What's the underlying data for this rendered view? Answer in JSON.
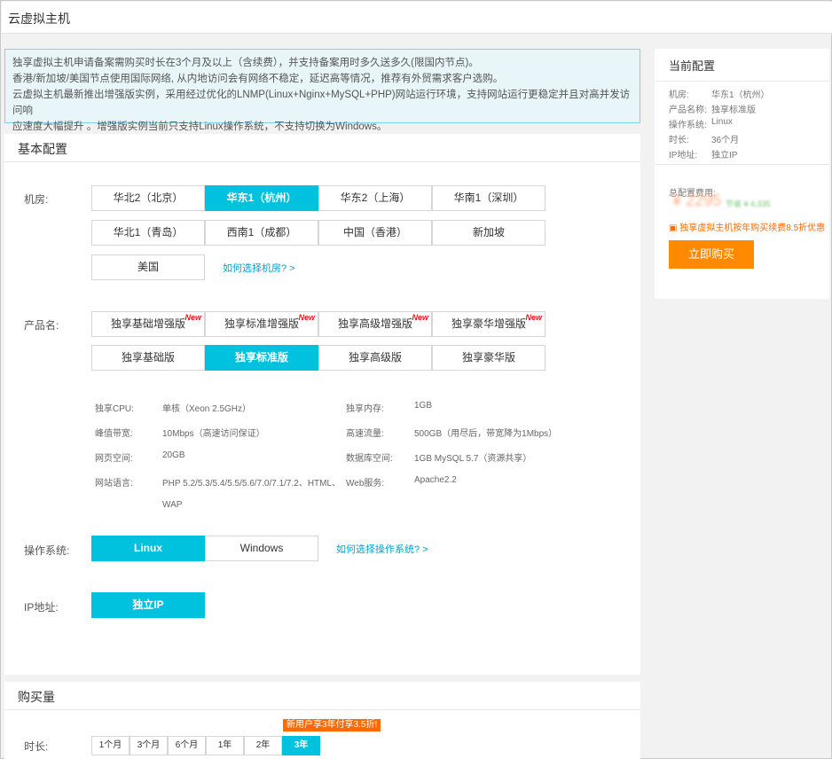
{
  "page_title": "云虚拟主机",
  "notice_lines": [
    "独享虚拟主机申请备案需购买时长在3个月及以上（含续费），并支持备案用时多久送多久(限国内节点)。",
    "香港/新加坡/美国节点使用国际网络, 从内地访问会有网络不稳定，延迟高等情况，推荐有外贸需求客户选购。",
    "云虚拟主机最新推出增强版实例，采用经过优化的LNMP(Linux+Nginx+MySQL+PHP)网站运行环境，支持网站运行更稳定并且对高并发访问响",
    "应速度大幅提升 。增强版实例当前只支持Linux操作系统，不支持切换为Windows。"
  ],
  "basic": {
    "title": "基本配置",
    "room_label": "机房:",
    "rooms": [
      "华北2（北京）",
      "华东1（杭州）",
      "华东2（上海）",
      "华南1（深圳）",
      "华北1（青岛）",
      "西南1（成都）",
      "中国（香港）",
      "新加坡",
      "美国"
    ],
    "room_selected": 1,
    "room_help": "如何选择机房? >",
    "product_label": "产品名:",
    "products_enhanced": [
      "独享基础增强版",
      "独享标准增强版",
      "独享高级增强版",
      "独享豪华增强版"
    ],
    "new_badge": "New",
    "products_normal": [
      "独享基础版",
      "独享标准版",
      "独享高级版",
      "独享豪华版"
    ],
    "product_selected": "独享标准版",
    "specs": {
      "cpu_k": "独享CPU:",
      "cpu_v": "单核（Xeon 2.5GHz）",
      "mem_k": "独享内存:",
      "mem_v": "1GB",
      "bw_k": "峰值带宽:",
      "bw_v": "10Mbps（高速访问保证）",
      "traffic_k": "高速流量:",
      "traffic_v": "500GB（用尽后，带宽降为1Mbps）",
      "space_k": "网页空间:",
      "space_v": "20GB",
      "db_k": "数据库空间:",
      "db_v": "1GB MySQL 5.7（资源共享）",
      "lang_k": "网站语言:",
      "lang_v": "PHP 5.2/5.3/5.4/5.5/5.6/7.0/7.1/7.2、HTML、",
      "lang_v2": "WAP",
      "web_k": "Web服务:",
      "web_v": "Apache2.2"
    },
    "os_label": "操作系统:",
    "os_options": [
      "Linux",
      "Windows"
    ],
    "os_selected": "Linux",
    "os_help": "如何选择操作系统? >",
    "ip_label": "IP地址:",
    "ip_option": "独立IP"
  },
  "purchase": {
    "title": "购买量",
    "duration_label": "时长:",
    "durations": [
      "1个月",
      "3个月",
      "6个月",
      "1年",
      "2年",
      "3年"
    ],
    "duration_selected": "3年",
    "promo_tag": "新用户享3年付享3.5折!"
  },
  "side": {
    "title": "当前配置",
    "rows": [
      {
        "k": "机房:",
        "v": "华东1（杭州）"
      },
      {
        "k": "产品名称:",
        "v": "独享标准版"
      },
      {
        "k": "操作系统:",
        "v": "Linux"
      },
      {
        "k": "时长:",
        "v": "36个月"
      },
      {
        "k": "IP地址:",
        "v": "独立IP"
      }
    ],
    "total_label": "总配置费用:",
    "price": "¥ 2295",
    "price_note": "节省 ¥ 4,335",
    "promo": "独享虚拟主机按年购买续费8.5折优惠",
    "buy_label": "立即购买"
  },
  "colors": {
    "accent": "#00c1de",
    "orange": "#ff8a00",
    "promo": "#ff6a00",
    "new": "#e8131f"
  }
}
